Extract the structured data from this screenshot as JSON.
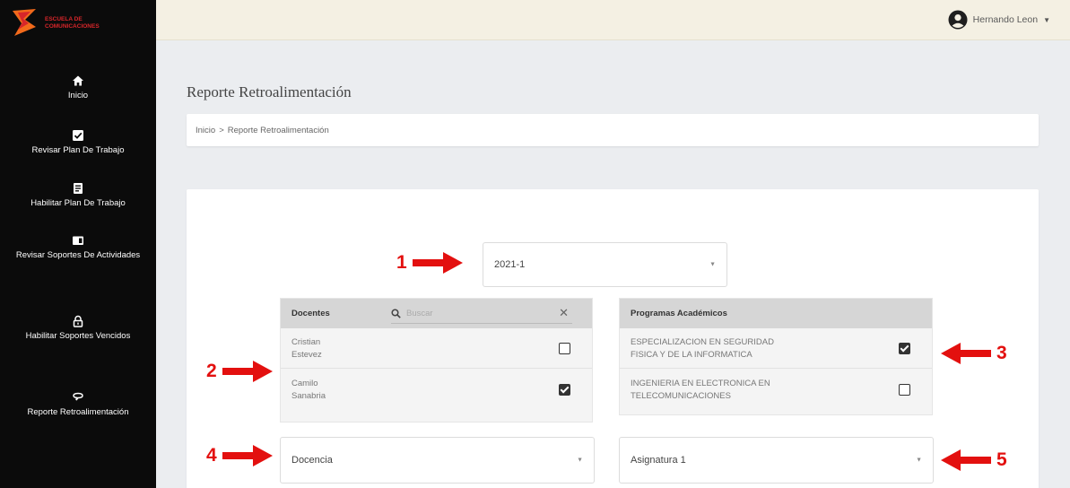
{
  "app": {
    "logo_text_line1": "ESCUELA DE",
    "logo_text_line2": "COMUNICACIONES",
    "brand_colors": {
      "orange": "#f26a1b",
      "red": "#d7262a",
      "sidebar": "#0b0b0b",
      "topbar": "#f4f0e3"
    }
  },
  "sidebar": {
    "items": [
      {
        "label": "Inicio",
        "icon": "home-icon"
      },
      {
        "label": "Revisar Plan De Trabajo",
        "icon": "check-square-icon"
      },
      {
        "label": "Habilitar Plan De Trabajo",
        "icon": "document-icon"
      },
      {
        "label": "Revisar Soportes De Actividades",
        "icon": "folder-icon"
      },
      {
        "label": "Habilitar Soportes Vencidos",
        "icon": "unlock-icon"
      },
      {
        "label": "Reporte Retroalimentación",
        "icon": "comment-icon"
      }
    ]
  },
  "header": {
    "user_name": "Hernando Leon",
    "user_icon": "user-circle-icon"
  },
  "page": {
    "title": "Reporte Retroalimentación",
    "breadcrumb": {
      "home": "Inicio",
      "separator": ">",
      "current": "Reporte Retroalimentación"
    }
  },
  "filters": {
    "period": {
      "value": "2021-1"
    },
    "activity_type": {
      "value": "Docencia"
    },
    "subject": {
      "value": "Asignatura 1"
    }
  },
  "docentes": {
    "header": "Docentes",
    "search_placeholder": "Buscar",
    "rows": [
      {
        "first": "Cristian",
        "last": "Estevez",
        "checked": false
      },
      {
        "first": "Camilo",
        "last": "Sanabria",
        "checked": true
      }
    ]
  },
  "programas": {
    "header": "Programas Académicos",
    "rows": [
      {
        "line1": "ESPECIALIZACION EN SEGURIDAD",
        "line2": "FISICA Y DE LA INFORMATICA",
        "checked": true
      },
      {
        "line1": "INGENIERIA EN ELECTRONICA EN",
        "line2": "TELECOMUNICACIONES",
        "checked": false
      }
    ]
  },
  "annotations": {
    "m1": "1",
    "m2": "2",
    "m3": "3",
    "m4": "4",
    "m5": "5",
    "color": "#e3100f"
  }
}
